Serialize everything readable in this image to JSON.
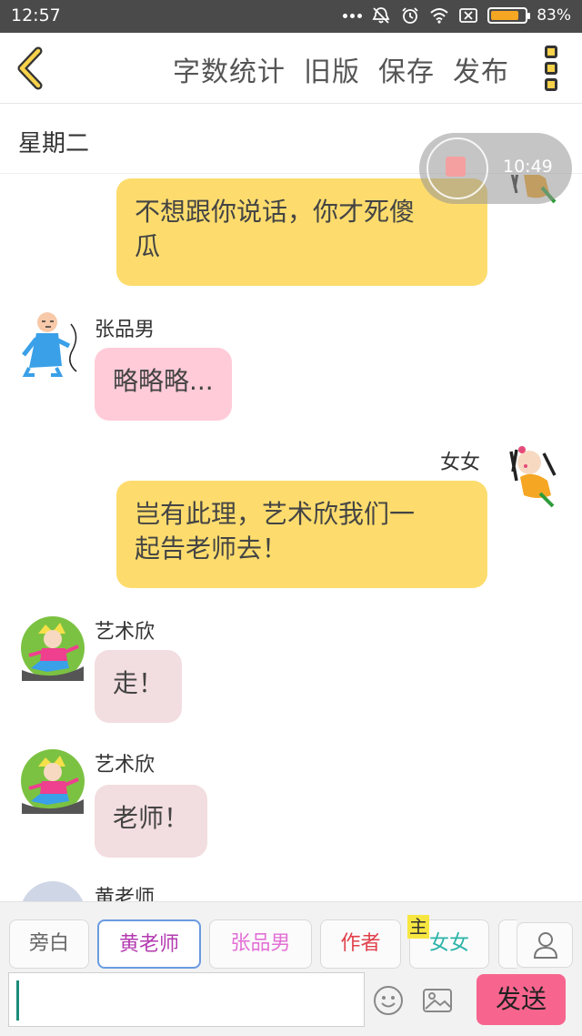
{
  "status_bar": {
    "time": "12:57",
    "battery_percent": "83%",
    "battery_level": 0.83
  },
  "header": {
    "actions": [
      "字数统计",
      "旧版",
      "保存",
      "发布"
    ]
  },
  "day_label": "星期二",
  "timer": {
    "elapsed": "10:49"
  },
  "messages": [
    {
      "speaker": "",
      "side": "right",
      "text_lines": [
        "不想跟你说话，你才死傻",
        "瓜"
      ]
    },
    {
      "speaker": "张品男",
      "side": "left",
      "text_lines": [
        "略略略..."
      ]
    },
    {
      "speaker": "女女",
      "side": "right",
      "text_lines": [
        "岂有此理，艺术欣我们一",
        "起告老师去！"
      ]
    },
    {
      "speaker": "艺术欣",
      "side": "left",
      "text_lines": [
        "走！"
      ]
    },
    {
      "speaker": "艺术欣",
      "side": "left",
      "text_lines": [
        "老师！"
      ]
    },
    {
      "speaker": "黄老师",
      "side": "left",
      "text_lines": []
    }
  ],
  "characters": [
    {
      "label": "旁白",
      "color": "#666666",
      "selected": false,
      "badge": ""
    },
    {
      "label": "黄老师",
      "color": "#b23ab0",
      "selected": true,
      "badge": ""
    },
    {
      "label": "张品男",
      "color": "#e36fd6",
      "selected": false,
      "badge": ""
    },
    {
      "label": "作者",
      "color": "#e0404a",
      "selected": false,
      "badge": ""
    },
    {
      "label": "女女",
      "color": "#2bb3a8",
      "selected": false,
      "badge": "主"
    }
  ],
  "input": {
    "value": "",
    "send_label": "发送"
  },
  "colors": {
    "bubble_yellow": "#fddc6d",
    "bubble_pink": "#ffcbd8",
    "send_button": "#f7658e",
    "status_bar": "#4a4a4a"
  }
}
